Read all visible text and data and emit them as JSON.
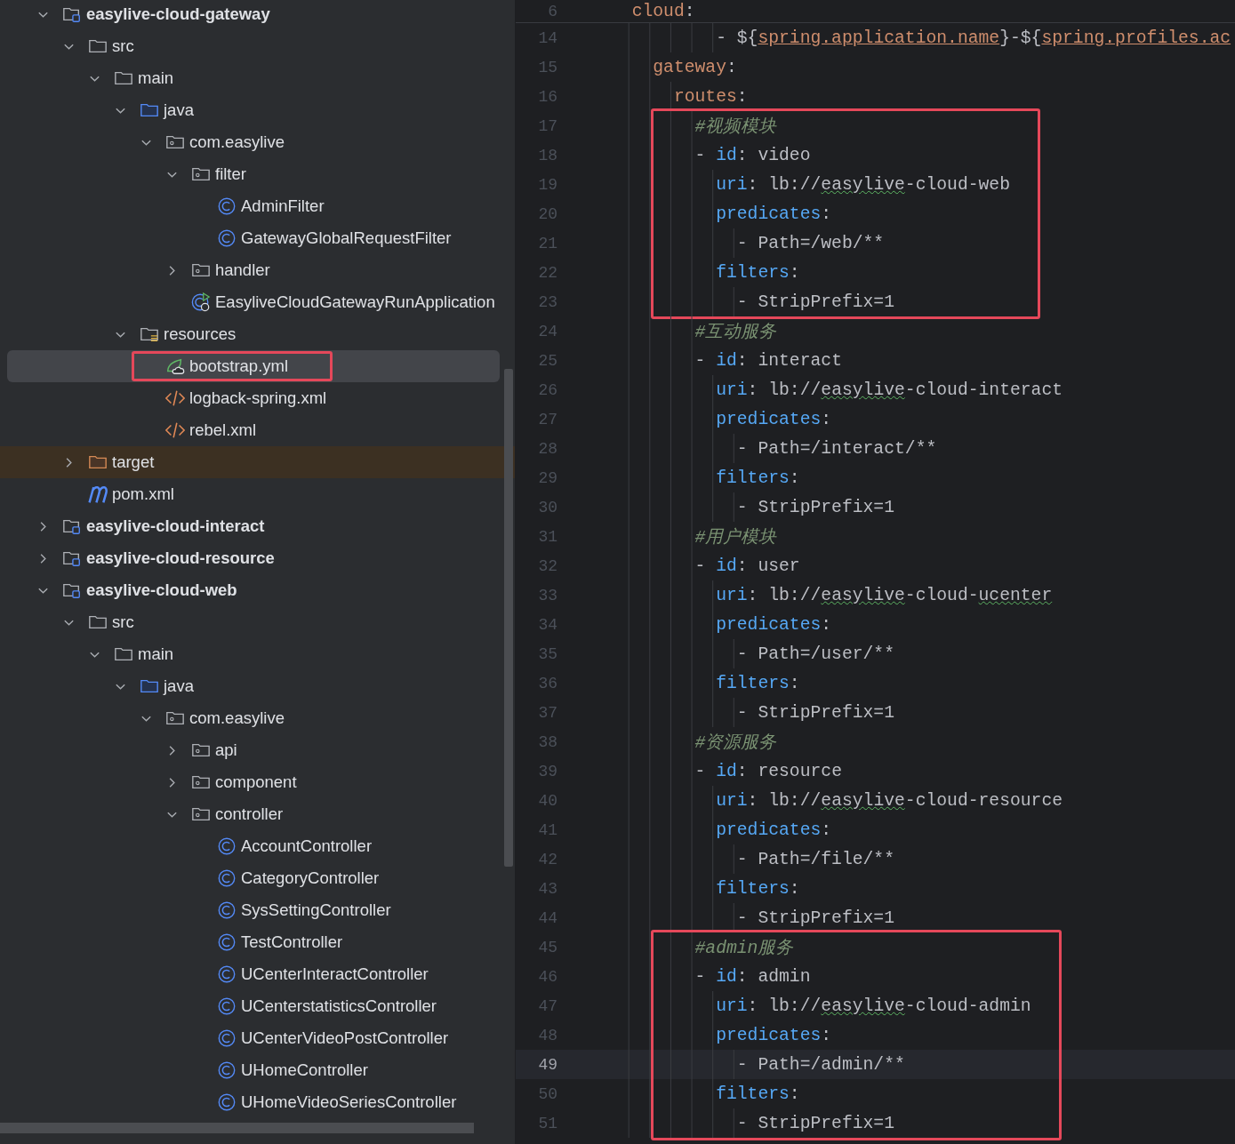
{
  "project_tree": {
    "items": [
      {
        "label": "easylive-cloud-gateway",
        "kind": "module",
        "expanded": true,
        "selected": false,
        "children": [
          {
            "label": "src",
            "kind": "folder",
            "expanded": true,
            "selected": false,
            "children": [
              {
                "label": "main",
                "kind": "folder",
                "expanded": true,
                "selected": false,
                "children": [
                  {
                    "label": "java",
                    "kind": "source-folder",
                    "expanded": true,
                    "selected": false,
                    "children": [
                      {
                        "label": "com.easylive",
                        "kind": "package",
                        "expanded": true,
                        "selected": false,
                        "children": [
                          {
                            "label": "filter",
                            "kind": "package",
                            "expanded": true,
                            "selected": false,
                            "children": [
                              {
                                "label": "AdminFilter",
                                "kind": "class",
                                "selected": false
                              },
                              {
                                "label": "GatewayGlobalRequestFilter",
                                "kind": "class",
                                "selected": false
                              }
                            ]
                          },
                          {
                            "label": "handler",
                            "kind": "package",
                            "expanded": false,
                            "selected": false
                          },
                          {
                            "label": "EasyliveCloudGatewayRunApplication",
                            "kind": "run-class",
                            "selected": false
                          }
                        ]
                      }
                    ]
                  },
                  {
                    "label": "resources",
                    "kind": "resources-folder",
                    "expanded": true,
                    "selected": false,
                    "children": [
                      {
                        "label": "bootstrap.yml",
                        "kind": "spring-yml",
                        "selected": true,
                        "outlined": true
                      },
                      {
                        "label": "logback-spring.xml",
                        "kind": "xml",
                        "selected": false
                      },
                      {
                        "label": "rebel.xml",
                        "kind": "xml",
                        "selected": false
                      }
                    ]
                  }
                ]
              }
            ]
          },
          {
            "label": "target",
            "kind": "excluded-folder",
            "expanded": false,
            "selected": false
          },
          {
            "label": "pom.xml",
            "kind": "maven",
            "selected": false
          }
        ]
      },
      {
        "label": "easylive-cloud-interact",
        "kind": "module",
        "expanded": false,
        "selected": false
      },
      {
        "label": "easylive-cloud-resource",
        "kind": "module",
        "expanded": false,
        "selected": false
      },
      {
        "label": "easylive-cloud-web",
        "kind": "module",
        "expanded": true,
        "selected": false,
        "children": [
          {
            "label": "src",
            "kind": "folder",
            "expanded": true,
            "selected": false,
            "children": [
              {
                "label": "main",
                "kind": "folder",
                "expanded": true,
                "selected": false,
                "children": [
                  {
                    "label": "java",
                    "kind": "source-folder",
                    "expanded": true,
                    "selected": false,
                    "children": [
                      {
                        "label": "com.easylive",
                        "kind": "package",
                        "expanded": true,
                        "selected": false,
                        "children": [
                          {
                            "label": "api",
                            "kind": "package",
                            "expanded": false,
                            "selected": false
                          },
                          {
                            "label": "component",
                            "kind": "package",
                            "expanded": false,
                            "selected": false
                          },
                          {
                            "label": "controller",
                            "kind": "package",
                            "expanded": true,
                            "selected": false,
                            "children": [
                              {
                                "label": "AccountController",
                                "kind": "class",
                                "selected": false
                              },
                              {
                                "label": "CategoryController",
                                "kind": "class",
                                "selected": false
                              },
                              {
                                "label": "SysSettingController",
                                "kind": "class",
                                "selected": false
                              },
                              {
                                "label": "TestController",
                                "kind": "class",
                                "selected": false
                              },
                              {
                                "label": "UCenterInteractController",
                                "kind": "class",
                                "selected": false
                              },
                              {
                                "label": "UCenterstatisticsController",
                                "kind": "class",
                                "selected": false
                              },
                              {
                                "label": "UCenterVideoPostController",
                                "kind": "class",
                                "selected": false
                              },
                              {
                                "label": "UHomeController",
                                "kind": "class",
                                "selected": false
                              },
                              {
                                "label": "UHomeVideoSeriesController",
                                "kind": "class",
                                "selected": false
                              }
                            ]
                          }
                        ]
                      }
                    ]
                  }
                ]
              }
            ]
          }
        ]
      }
    ]
  },
  "editor": {
    "sticky_line": {
      "n": "6",
      "tokens": [
        {
          "text": "  cloud",
          "kind": "key"
        },
        {
          "text": ":",
          "kind": "plain"
        }
      ]
    },
    "groups": [
      {
        "outlined": false,
        "lines": [
          {
            "n": "14",
            "current": false,
            "tokens": [
              {
                "text": "          - ${",
                "kind": "plain"
              },
              {
                "text": "spring.application.name",
                "kind": "ref"
              },
              {
                "text": "}-${",
                "kind": "plain"
              },
              {
                "text": "spring.profiles.ac",
                "kind": "ref"
              }
            ]
          },
          {
            "n": "15",
            "current": false,
            "tokens": [
              {
                "text": "    gateway",
                "kind": "key"
              },
              {
                "text": ":",
                "kind": "plain"
              }
            ]
          },
          {
            "n": "16",
            "current": false,
            "tokens": [
              {
                "text": "      routes",
                "kind": "key"
              },
              {
                "text": ":",
                "kind": "plain"
              }
            ]
          }
        ]
      },
      {
        "outlined": true,
        "lines": [
          {
            "n": "17",
            "current": false,
            "tokens": [
              {
                "text": "        #视频模块",
                "kind": "comment"
              }
            ]
          },
          {
            "n": "18",
            "current": false,
            "tokens": [
              {
                "text": "        - ",
                "kind": "plain"
              },
              {
                "text": "id",
                "kind": "prop"
              },
              {
                "text": ": video",
                "kind": "plain"
              }
            ]
          },
          {
            "n": "19",
            "current": false,
            "tokens": [
              {
                "text": "          uri",
                "kind": "prop"
              },
              {
                "text": ": lb://",
                "kind": "plain"
              },
              {
                "text": "easylive",
                "kind": "typo"
              },
              {
                "text": "-cloud-web",
                "kind": "plain"
              }
            ]
          },
          {
            "n": "20",
            "current": false,
            "tokens": [
              {
                "text": "          predicates",
                "kind": "prop"
              },
              {
                "text": ":",
                "kind": "plain"
              }
            ]
          },
          {
            "n": "21",
            "current": false,
            "tokens": [
              {
                "text": "            - Path=/web/**",
                "kind": "plain"
              }
            ]
          },
          {
            "n": "22",
            "current": false,
            "tokens": [
              {
                "text": "          filters",
                "kind": "prop"
              },
              {
                "text": ":",
                "kind": "plain"
              }
            ]
          },
          {
            "n": "23",
            "current": false,
            "tokens": [
              {
                "text": "            - StripPrefix=1",
                "kind": "plain"
              }
            ]
          }
        ]
      },
      {
        "outlined": false,
        "lines": [
          {
            "n": "24",
            "current": false,
            "tokens": [
              {
                "text": "        #互动服务",
                "kind": "comment"
              }
            ]
          },
          {
            "n": "25",
            "current": false,
            "tokens": [
              {
                "text": "        - ",
                "kind": "plain"
              },
              {
                "text": "id",
                "kind": "prop"
              },
              {
                "text": ": interact",
                "kind": "plain"
              }
            ]
          },
          {
            "n": "26",
            "current": false,
            "tokens": [
              {
                "text": "          uri",
                "kind": "prop"
              },
              {
                "text": ": lb://",
                "kind": "plain"
              },
              {
                "text": "easylive",
                "kind": "typo"
              },
              {
                "text": "-cloud-interact",
                "kind": "plain"
              }
            ]
          },
          {
            "n": "27",
            "current": false,
            "tokens": [
              {
                "text": "          predicates",
                "kind": "prop"
              },
              {
                "text": ":",
                "kind": "plain"
              }
            ]
          },
          {
            "n": "28",
            "current": false,
            "tokens": [
              {
                "text": "            - Path=/interact/**",
                "kind": "plain"
              }
            ]
          },
          {
            "n": "29",
            "current": false,
            "tokens": [
              {
                "text": "          filters",
                "kind": "prop"
              },
              {
                "text": ":",
                "kind": "plain"
              }
            ]
          },
          {
            "n": "30",
            "current": false,
            "tokens": [
              {
                "text": "            - StripPrefix=1",
                "kind": "plain"
              }
            ]
          },
          {
            "n": "31",
            "current": false,
            "tokens": [
              {
                "text": "        #用户模块",
                "kind": "comment"
              }
            ]
          },
          {
            "n": "32",
            "current": false,
            "tokens": [
              {
                "text": "        - ",
                "kind": "plain"
              },
              {
                "text": "id",
                "kind": "prop"
              },
              {
                "text": ": user",
                "kind": "plain"
              }
            ]
          },
          {
            "n": "33",
            "current": false,
            "tokens": [
              {
                "text": "          uri",
                "kind": "prop"
              },
              {
                "text": ": lb://",
                "kind": "plain"
              },
              {
                "text": "easylive",
                "kind": "typo"
              },
              {
                "text": "-cloud-",
                "kind": "plain"
              },
              {
                "text": "ucenter",
                "kind": "typo"
              }
            ]
          },
          {
            "n": "34",
            "current": false,
            "tokens": [
              {
                "text": "          predicates",
                "kind": "prop"
              },
              {
                "text": ":",
                "kind": "plain"
              }
            ]
          },
          {
            "n": "35",
            "current": false,
            "tokens": [
              {
                "text": "            - Path=/user/**",
                "kind": "plain"
              }
            ]
          },
          {
            "n": "36",
            "current": false,
            "tokens": [
              {
                "text": "          filters",
                "kind": "prop"
              },
              {
                "text": ":",
                "kind": "plain"
              }
            ]
          },
          {
            "n": "37",
            "current": false,
            "tokens": [
              {
                "text": "            - StripPrefix=1",
                "kind": "plain"
              }
            ]
          },
          {
            "n": "38",
            "current": false,
            "tokens": [
              {
                "text": "        #资源服务",
                "kind": "comment"
              }
            ]
          },
          {
            "n": "39",
            "current": false,
            "tokens": [
              {
                "text": "        - ",
                "kind": "plain"
              },
              {
                "text": "id",
                "kind": "prop"
              },
              {
                "text": ": resource",
                "kind": "plain"
              }
            ]
          },
          {
            "n": "40",
            "current": false,
            "tokens": [
              {
                "text": "          uri",
                "kind": "prop"
              },
              {
                "text": ": lb://",
                "kind": "plain"
              },
              {
                "text": "easylive",
                "kind": "typo"
              },
              {
                "text": "-cloud-resource",
                "kind": "plain"
              }
            ]
          },
          {
            "n": "41",
            "current": false,
            "tokens": [
              {
                "text": "          predicates",
                "kind": "prop"
              },
              {
                "text": ":",
                "kind": "plain"
              }
            ]
          },
          {
            "n": "42",
            "current": false,
            "tokens": [
              {
                "text": "            - Path=/file/**",
                "kind": "plain"
              }
            ]
          },
          {
            "n": "43",
            "current": false,
            "tokens": [
              {
                "text": "          filters",
                "kind": "prop"
              },
              {
                "text": ":",
                "kind": "plain"
              }
            ]
          },
          {
            "n": "44",
            "current": false,
            "tokens": [
              {
                "text": "            - StripPrefix=1",
                "kind": "plain"
              }
            ]
          }
        ]
      },
      {
        "outlined": true,
        "lines": [
          {
            "n": "45",
            "current": false,
            "tokens": [
              {
                "text": "        #admin服务",
                "kind": "comment"
              }
            ]
          },
          {
            "n": "46",
            "current": false,
            "tokens": [
              {
                "text": "        - ",
                "kind": "plain"
              },
              {
                "text": "id",
                "kind": "prop"
              },
              {
                "text": ": admin",
                "kind": "plain"
              }
            ]
          },
          {
            "n": "47",
            "current": false,
            "tokens": [
              {
                "text": "          uri",
                "kind": "prop"
              },
              {
                "text": ": lb://",
                "kind": "plain"
              },
              {
                "text": "easylive",
                "kind": "typo"
              },
              {
                "text": "-cloud-admin",
                "kind": "plain"
              }
            ]
          },
          {
            "n": "48",
            "current": false,
            "tokens": [
              {
                "text": "          predicates",
                "kind": "prop"
              },
              {
                "text": ":",
                "kind": "plain"
              }
            ]
          },
          {
            "n": "49",
            "current": true,
            "tokens": [
              {
                "text": "            - Path=/admin/**",
                "kind": "plain"
              }
            ]
          },
          {
            "n": "50",
            "current": false,
            "tokens": [
              {
                "text": "          filters",
                "kind": "prop"
              },
              {
                "text": ":",
                "kind": "plain"
              }
            ]
          },
          {
            "n": "51",
            "current": false,
            "tokens": [
              {
                "text": "            - StripPrefix=1",
                "kind": "plain"
              }
            ]
          }
        ]
      }
    ]
  }
}
